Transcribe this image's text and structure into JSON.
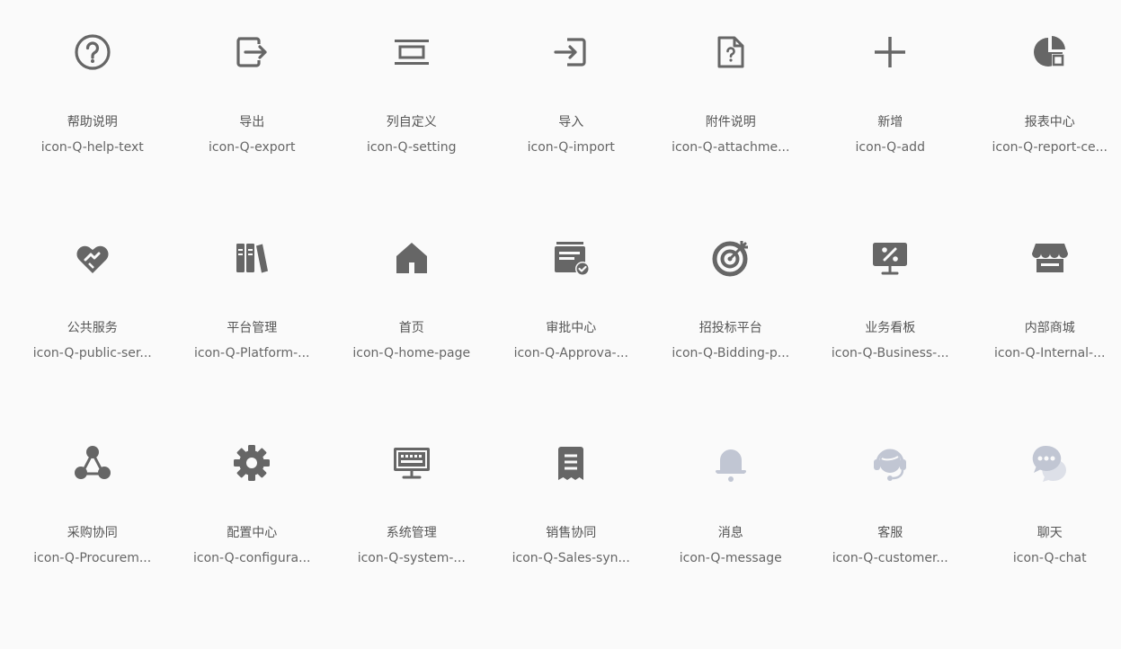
{
  "colors": {
    "icon_dark": "#666666",
    "icon_light": "#c1c6d3",
    "text_cn": "#555555",
    "text_code": "#666666",
    "background": "#fafafa"
  },
  "icons": [
    {
      "cn": "帮助说明",
      "code": "icon-Q-help-text",
      "icon": "help-circle-icon"
    },
    {
      "cn": "导出",
      "code": "icon-Q-export",
      "icon": "export-icon"
    },
    {
      "cn": "列自定义",
      "code": "icon-Q-setting",
      "icon": "column-setting-icon"
    },
    {
      "cn": "导入",
      "code": "icon-Q-import",
      "icon": "import-icon"
    },
    {
      "cn": "附件说明",
      "code": "icon-Q-attachme...",
      "icon": "attachment-doc-icon"
    },
    {
      "cn": "新增",
      "code": "icon-Q-add",
      "icon": "plus-icon"
    },
    {
      "cn": "报表中心",
      "code": "icon-Q-report-ce...",
      "icon": "report-center-icon"
    },
    {
      "cn": "公共服务",
      "code": "icon-Q-public-ser...",
      "icon": "heart-handshake-icon"
    },
    {
      "cn": "平台管理",
      "code": "icon-Q-Platform-...",
      "icon": "books-icon"
    },
    {
      "cn": "首页",
      "code": "icon-Q-home-page",
      "icon": "home-icon"
    },
    {
      "cn": "审批中心",
      "code": "icon-Q-Approva-...",
      "icon": "approval-card-icon"
    },
    {
      "cn": "招投标平台",
      "code": "icon-Q-Bidding-p...",
      "icon": "target-arrow-icon"
    },
    {
      "cn": "业务看板",
      "code": "icon-Q-Business-...",
      "icon": "percent-board-icon"
    },
    {
      "cn": "内部商城",
      "code": "icon-Q-Internal-...",
      "icon": "store-icon"
    },
    {
      "cn": "采购协同",
      "code": "icon-Q-Procurem...",
      "icon": "network-nodes-icon"
    },
    {
      "cn": "配置中心",
      "code": "icon-Q-configura...",
      "icon": "gear-icon"
    },
    {
      "cn": "系统管理",
      "code": "icon-Q-system-...",
      "icon": "keyboard-monitor-icon"
    },
    {
      "cn": "销售协同",
      "code": "icon-Q-Sales-syn...",
      "icon": "receipt-icon"
    },
    {
      "cn": "消息",
      "code": "icon-Q-message",
      "icon": "bell-icon"
    },
    {
      "cn": "客服",
      "code": "icon-Q-customer...",
      "icon": "headset-icon"
    },
    {
      "cn": "聊天",
      "code": "icon-Q-chat",
      "icon": "chat-bubbles-icon"
    }
  ]
}
